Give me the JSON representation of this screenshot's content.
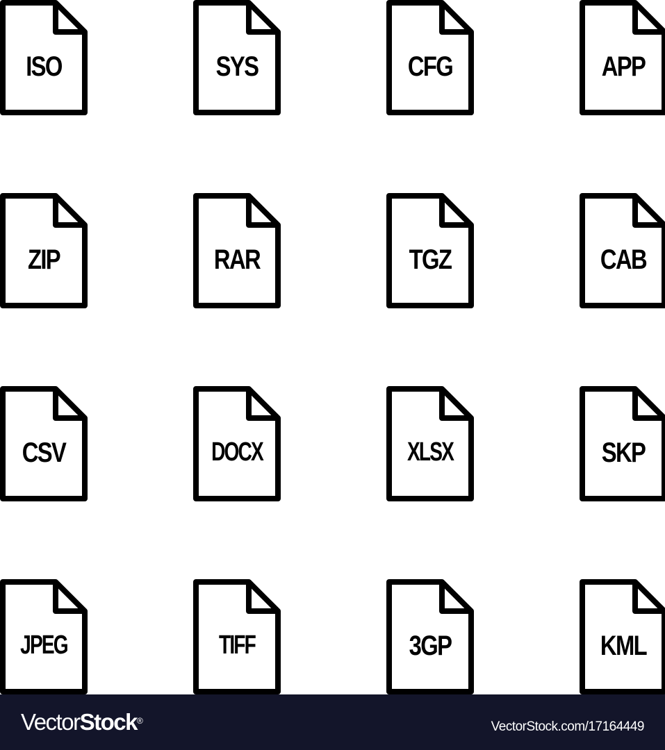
{
  "icons": [
    {
      "label": "ISO",
      "icon": "iso-file-icon"
    },
    {
      "label": "SYS",
      "icon": "sys-file-icon"
    },
    {
      "label": "CFG",
      "icon": "cfg-file-icon"
    },
    {
      "label": "APP",
      "icon": "app-file-icon"
    },
    {
      "label": "ZIP",
      "icon": "zip-file-icon"
    },
    {
      "label": "RAR",
      "icon": "rar-file-icon"
    },
    {
      "label": "TGZ",
      "icon": "tgz-file-icon"
    },
    {
      "label": "CAB",
      "icon": "cab-file-icon"
    },
    {
      "label": "CSV",
      "icon": "csv-file-icon"
    },
    {
      "label": "DOCX",
      "icon": "docx-file-icon"
    },
    {
      "label": "XLSX",
      "icon": "xlsx-file-icon"
    },
    {
      "label": "SKP",
      "icon": "skp-file-icon"
    },
    {
      "label": "JPEG",
      "icon": "jpeg-file-icon"
    },
    {
      "label": "TIFF",
      "icon": "tiff-file-icon"
    },
    {
      "label": "3GP",
      "icon": "3gp-file-icon"
    },
    {
      "label": "KML",
      "icon": "kml-file-icon"
    }
  ],
  "footer": {
    "brand_light": "Vector",
    "brand_bold": "Stock",
    "brand_mark": "®",
    "stock_id": "VectorStock.com/17164449"
  },
  "colors": {
    "icon_stroke": "#000000",
    "background": "#ffffff",
    "footer_bg": "#13152a",
    "footer_text": "#ffffff"
  }
}
